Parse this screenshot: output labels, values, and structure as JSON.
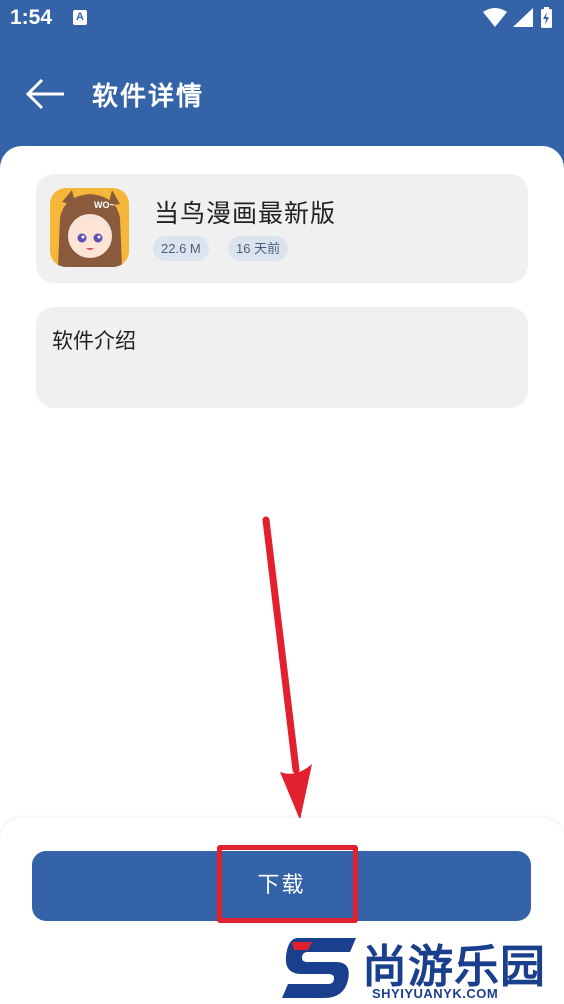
{
  "status_bar": {
    "time": "1:54",
    "notification_glyph": "A",
    "icons": [
      "wifi-icon",
      "signal-icon",
      "battery-charging-icon"
    ]
  },
  "app_bar": {
    "title": "软件详情",
    "back_icon": "arrow-left-icon"
  },
  "app_card": {
    "name": "当鸟漫画最新版",
    "size": "22.6 M",
    "updated": "16 天前",
    "icon_badge_text": "WO~"
  },
  "intro": {
    "label": "软件介绍"
  },
  "footer": {
    "download_label": "下载"
  },
  "annotation": {
    "highlight_color": "#e2202e"
  },
  "watermark": {
    "text": "尚游乐园",
    "url": "SHYIYUANYK.COM"
  },
  "colors": {
    "primary": "#3563a8",
    "card_bg": "#f0f0f0",
    "chip_bg": "#dbe3ee"
  }
}
